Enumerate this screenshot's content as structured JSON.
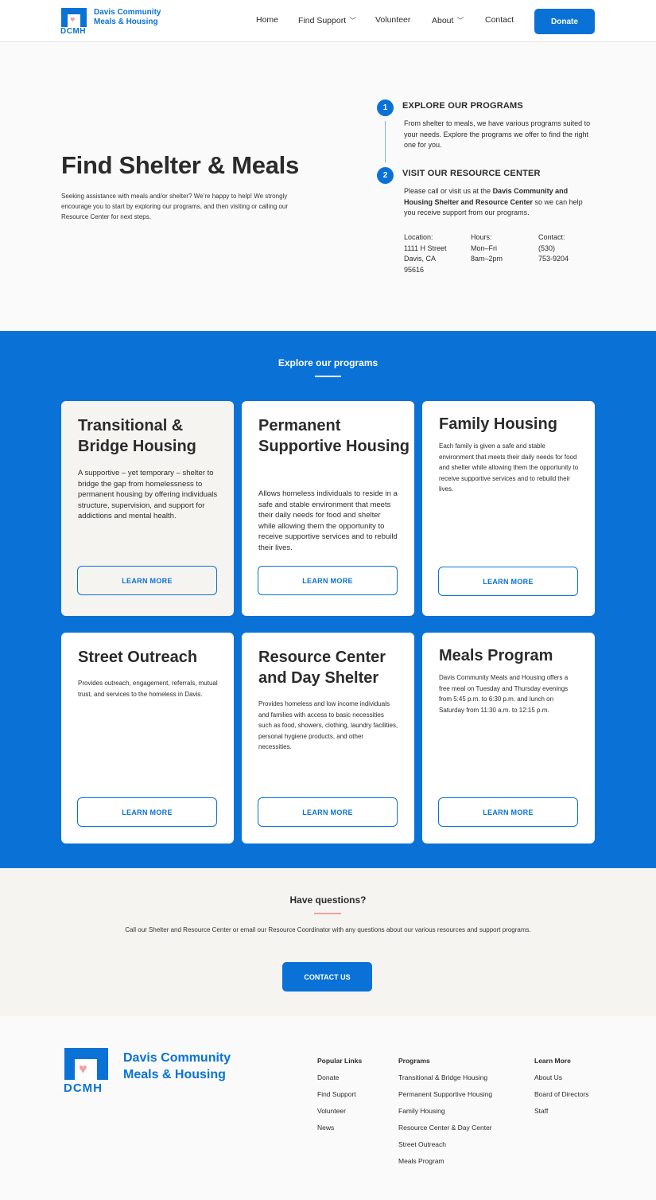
{
  "header": {
    "logo_abbr": "DCMH",
    "logo_name": "Davis Community Meals & Housing",
    "nav": [
      "Home",
      "Find Support",
      "Volunteer",
      "About",
      "Contact"
    ],
    "donate_label": "Donate"
  },
  "hero": {
    "title": "Find Shelter & Meals",
    "description": "Seeking assistance with meals and/or shelter? We’re happy to help! We strongly encourage you to start by exploring our programs, and then visiting or calling our Resource Center for next steps.",
    "steps": [
      {
        "number": "1",
        "title": "EXPLORE OUR PROGRAMS",
        "text": "From shelter to meals, we have various programs suited to your needs. Explore the programs we offer to find the right one for you."
      },
      {
        "number": "2",
        "title": "VISIT OUR RESOURCE CENTER",
        "text_before": "Please call or visit us at the ",
        "text_bold": "Davis Community and Housing Shelter and Resource Center",
        "text_after": " so we can help you receive support from our programs."
      }
    ],
    "info": {
      "location_label": "Location:",
      "location_line1": "1111 H Street",
      "location_line2": "Davis, CA",
      "location_line3": "95616",
      "hours_label": "Hours:",
      "hours_line1": "Mon–Fri",
      "hours_line2": "8am–2pm",
      "contact_label": "Contact:",
      "contact_line1": "(530)",
      "contact_line2": "753-9204"
    }
  },
  "programs": {
    "title": "Explore our programs",
    "learn_more": "LEARN MORE",
    "cards": [
      {
        "title": "Transitional & Bridge Housing",
        "text": "A supportive – yet temporary – shelter to bridge the gap from homelessness to permanent housing by offering individuals structure, supervision, and support for addictions and mental health."
      },
      {
        "title": "Permanent Supportive Housing",
        "text": "Allows homeless individuals to reside in a safe and stable environment that meets their daily needs for food and shelter while allowing them the opportunity to receive supportive services and to rebuild their lives."
      },
      {
        "title": "Family Housing",
        "text": "Each family is given a safe and stable environment that meets their daily needs for food and shelter while allowing them the opportunity to receive supportive services and to rebuild their lives."
      },
      {
        "title": "Street Outreach",
        "text": "Provides outreach, engagement, referrals, mutual trust, and services to the homeless in Davis."
      },
      {
        "title": "Resource Center and Day Shelter",
        "text": "Provides homeless and low income individuals and families with access to basic necessities such as food, showers, clothing, laundry facilities, personal hygiene products, and other necessities."
      },
      {
        "title": "Meals Program",
        "text": "Davis Community Meals and Housing offers a free meal on Tuesday and Thursday evenings from 5:45 p.m. to 6:30 p.m. and lunch on Saturday from 11:30 a.m. to 12:15 p.m."
      }
    ]
  },
  "questions": {
    "title": "Have questions?",
    "text": "Call our Shelter and Resource Center or email our Resource Coordinator with any questions about our various resources and support programs.",
    "button": "CONTACT US"
  },
  "footer": {
    "logo_abbr": "DCMH",
    "logo_name": "Davis Community Meals & Housing",
    "popular_links": {
      "heading": "Popular Links",
      "items": [
        "Donate",
        "Find Support",
        "Volunteer",
        "News"
      ]
    },
    "programs": {
      "heading": "Programs",
      "items": [
        "Transitional & Bridge Housing",
        "Permanent Supportive Housing",
        "Family Housing",
        "Resource Center & Day Center",
        "Street Outreach",
        "Meals Program"
      ]
    },
    "learn_more": {
      "heading": "Learn More",
      "items": [
        "About Us",
        "Board of Directors",
        "Staff"
      ]
    }
  },
  "colors": {
    "brand_blue": "#0a72d6",
    "accent_pink": "#f2a0a0",
    "tan": "#f6f4f0"
  }
}
